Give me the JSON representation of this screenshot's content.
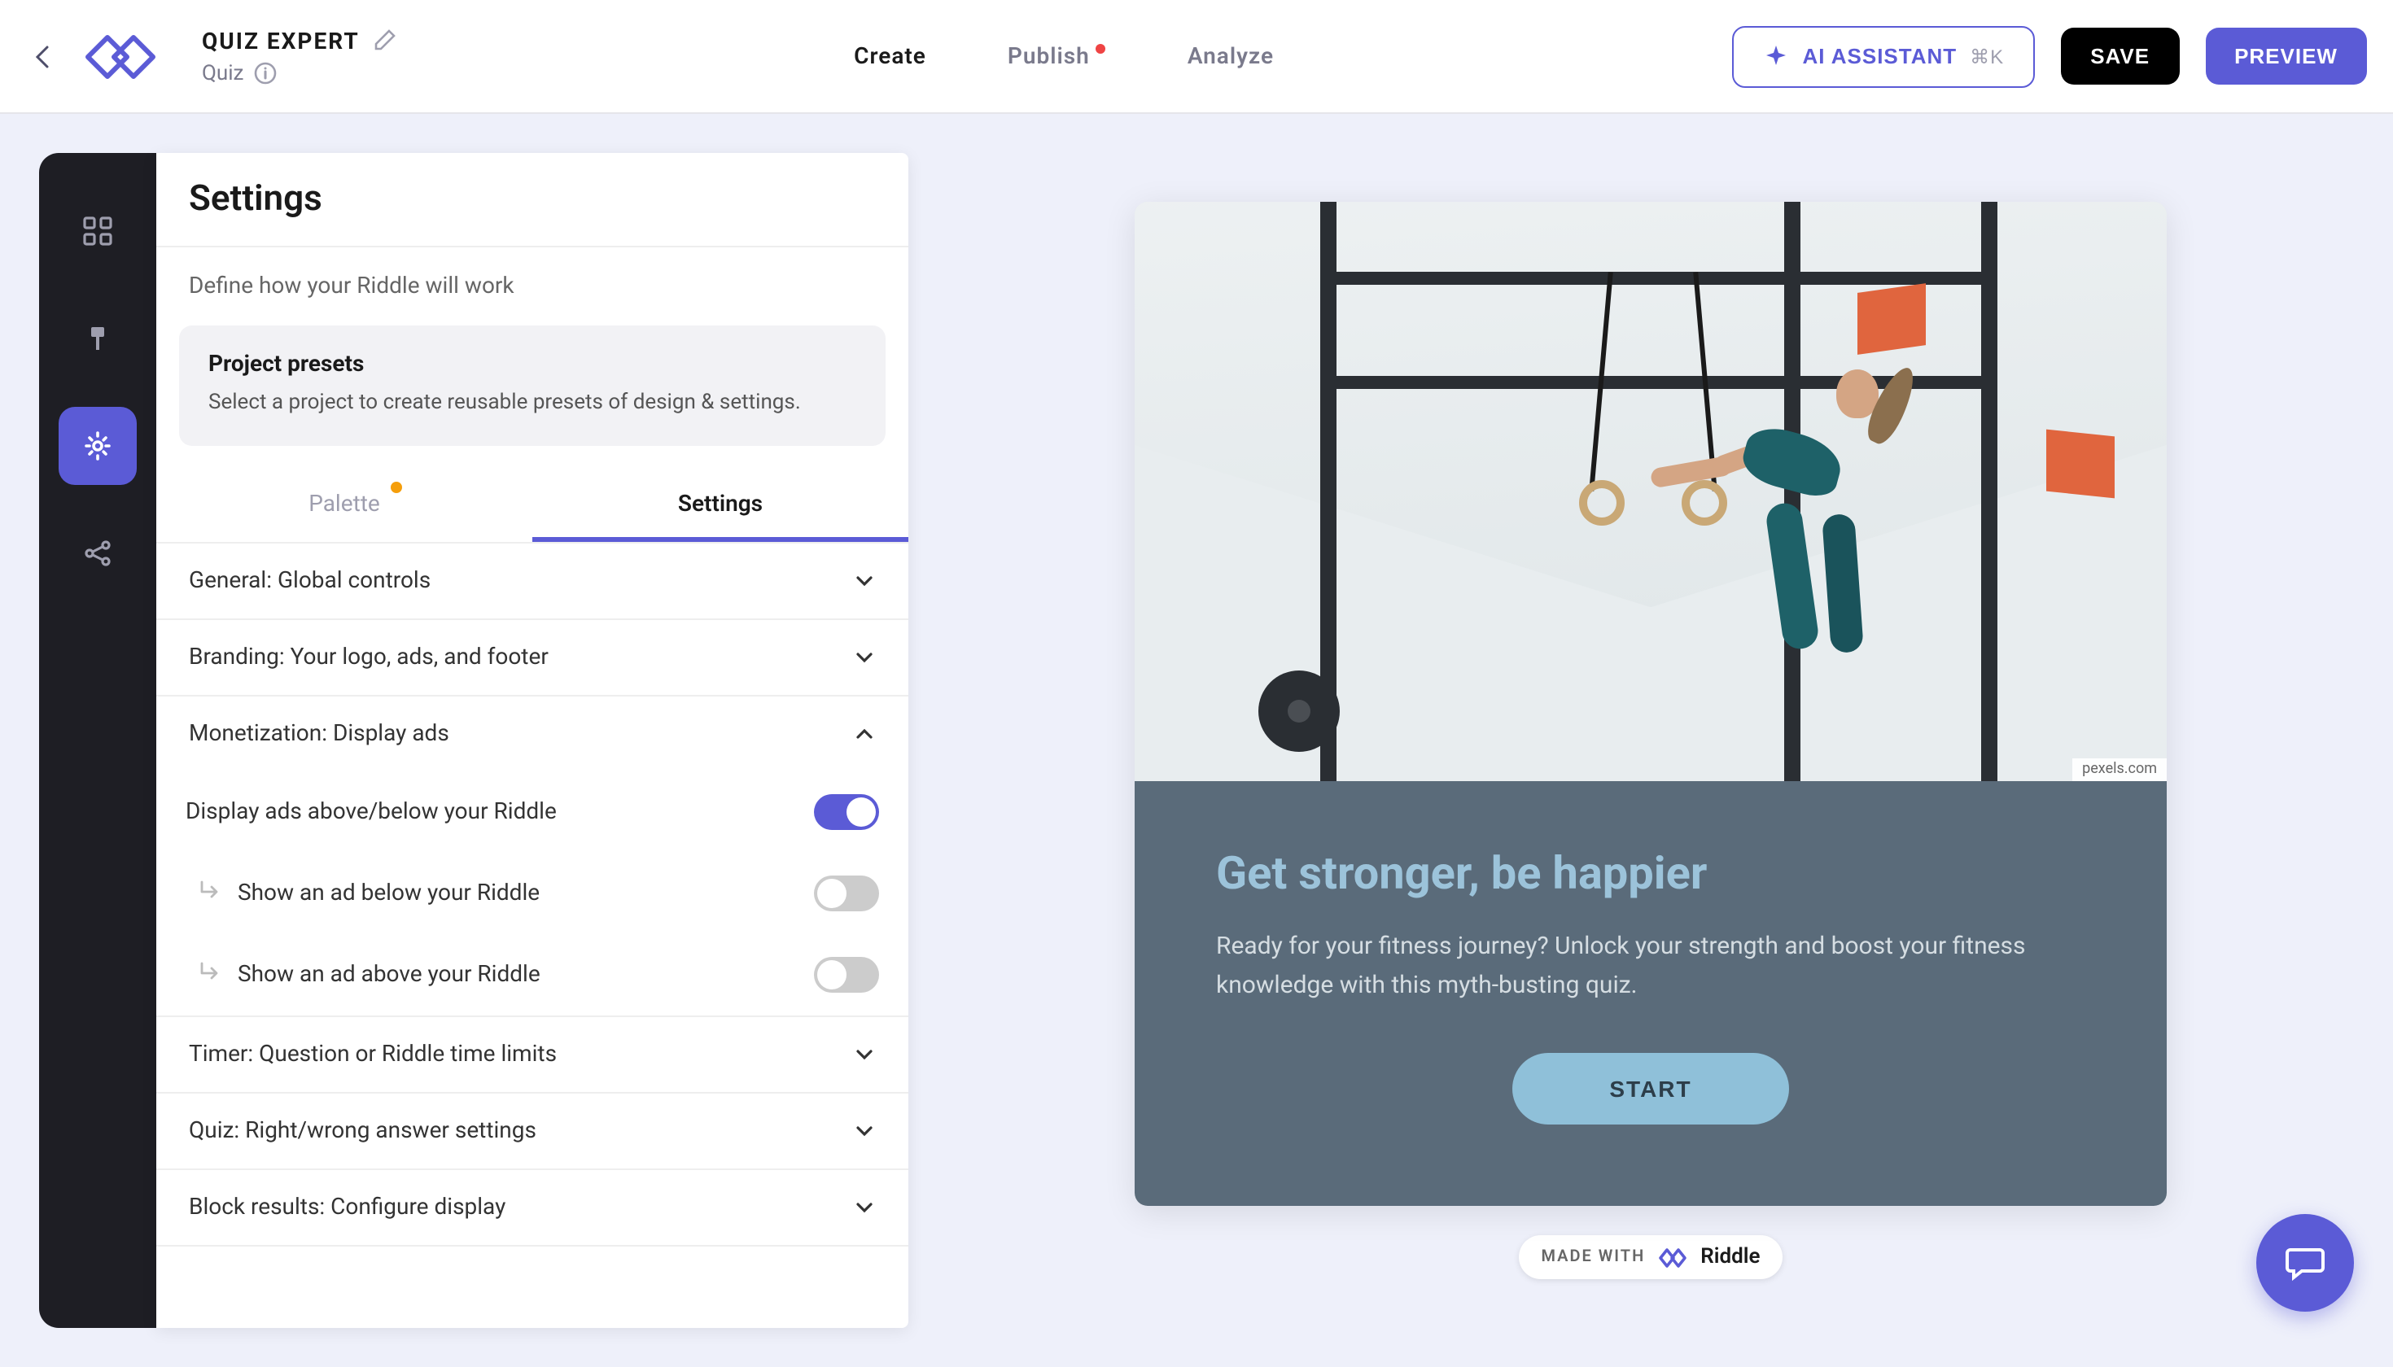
{
  "header": {
    "title": "QUIZ EXPERT",
    "subtitle": "Quiz",
    "nav": {
      "create": "Create",
      "publish": "Publish",
      "analyze": "Analyze"
    },
    "ai_button": "AI ASSISTANT",
    "ai_shortcut": "⌘K",
    "save": "SAVE",
    "preview": "PREVIEW"
  },
  "panel": {
    "title": "Settings",
    "subtitle": "Define how your Riddle will work",
    "preset": {
      "title": "Project presets",
      "desc": "Select a project to create reusable presets of design & settings."
    },
    "tabs": {
      "palette": "Palette",
      "settings": "Settings"
    },
    "sections": {
      "general": "General: Global controls",
      "branding": "Branding: Your logo, ads, and footer",
      "monetization": "Monetization: Display ads",
      "timer": "Timer: Question or Riddle time limits",
      "quiz": "Quiz: Right/wrong answer settings",
      "block_results": "Block results: Configure display"
    },
    "monetization_settings": {
      "display_ads": "Display ads above/below your Riddle",
      "ad_below": "Show an ad below your Riddle",
      "ad_above": "Show an ad above your Riddle"
    }
  },
  "preview": {
    "img_credit": "pexels.com",
    "title": "Get stronger, be happier",
    "desc": "Ready for your fitness journey? Unlock your strength and boost your fitness knowledge with this myth-busting quiz.",
    "start": "START",
    "made_with": "MADE WITH",
    "brand": "Riddle"
  }
}
